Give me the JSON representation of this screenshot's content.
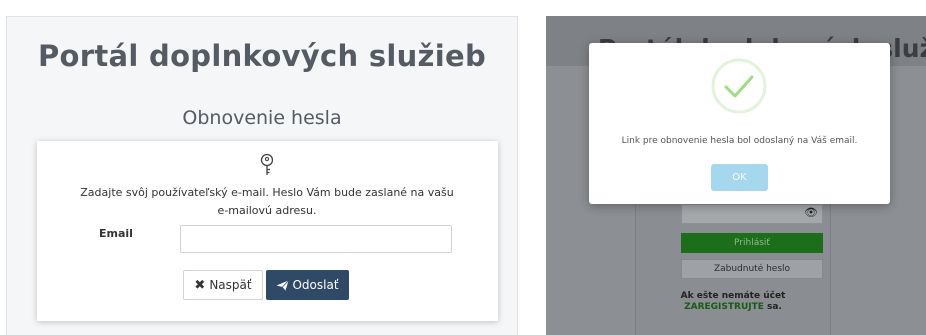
{
  "left_panel": {
    "title": "Portál doplnkových služieb",
    "subtitle": "Obnovenie hesla",
    "icon": "key-icon",
    "info_text": "Zadajte svôj používateľský e-mail. Heslo Vám bude zaslané na vašu e-mailovú adresu.",
    "email_label": "Email",
    "email_value": "",
    "email_placeholder": "",
    "back_button_label": "Naspäť",
    "back_button_icon": "close-icon",
    "send_button_label": "Odoslať",
    "send_button_icon": "paper-plane-icon",
    "send_button_color": "#2f4a66"
  },
  "right_panel": {
    "background": {
      "title": "Portál doplnkových služieb",
      "password_visibility_icon": "eye-icon",
      "login_button_label": "Prihlásiť",
      "login_button_color": "#1d6e1a",
      "forgot_button_label": "Zabudnuté heslo",
      "no_account_text": "Ak ešte nemáte účet",
      "register_link": "ZAREGISTRUJTE",
      "register_suffix": " sa."
    },
    "modal": {
      "icon": "checkmark-icon",
      "icon_color": "#9edc87",
      "message": "Link pre obnovenie hesla bol odoslaný na Váš email.",
      "ok_button_label": "OK",
      "ok_button_color": "#a5d7ee"
    }
  }
}
